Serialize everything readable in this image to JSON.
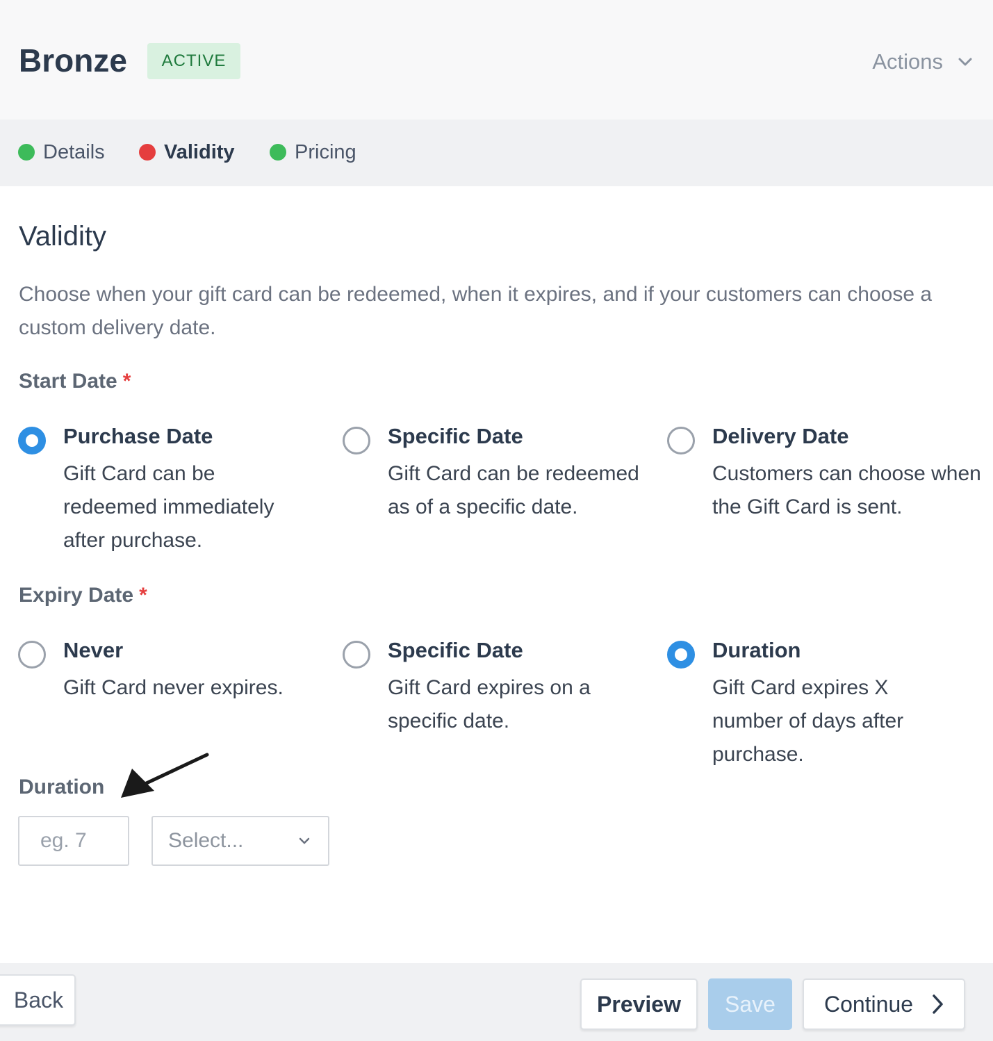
{
  "header": {
    "title": "Bronze",
    "status_badge": "ACTIVE",
    "actions_label": "Actions",
    "actions_icon": "chevron-down-icon"
  },
  "tabs": [
    {
      "label": "Details",
      "status_color": "#3dbb5a",
      "active": false
    },
    {
      "label": "Validity",
      "status_color": "#e53e3e",
      "active": true
    },
    {
      "label": "Pricing",
      "status_color": "#3dbb5a",
      "active": false
    }
  ],
  "section": {
    "title": "Validity",
    "description": "Choose when your gift card can be redeemed, when it expires, and if your customers can choose a custom delivery date."
  },
  "start_date": {
    "label": "Start Date",
    "required_mark": "*",
    "options": [
      {
        "title": "Purchase Date",
        "description": "Gift Card can be redeemed immediately after purchase.",
        "selected": true
      },
      {
        "title": "Specific Date",
        "description": "Gift Card can be redeemed as of a specific date.",
        "selected": false
      },
      {
        "title": "Delivery Date",
        "description": "Customers can choose when the Gift Card is sent.",
        "selected": false
      }
    ]
  },
  "expiry_date": {
    "label": "Expiry Date",
    "required_mark": "*",
    "options": [
      {
        "title": "Never",
        "description": "Gift Card never expires.",
        "selected": false
      },
      {
        "title": "Specific Date",
        "description": "Gift Card expires on a specific date.",
        "selected": false
      },
      {
        "title": "Duration",
        "description": "Gift Card expires X number of days after purchase.",
        "selected": true
      }
    ]
  },
  "duration": {
    "label": "Duration",
    "input_value": "",
    "input_placeholder": "eg. 7",
    "select_placeholder": "Select..."
  },
  "footer": {
    "back_label": "Back",
    "preview_label": "Preview",
    "save_label": "Save",
    "continue_label": "Continue"
  },
  "colors": {
    "accent": "#2e8fe3",
    "success": "#3dbb5a",
    "error": "#e53e3e",
    "save_disabled": "#a9cdeb"
  }
}
